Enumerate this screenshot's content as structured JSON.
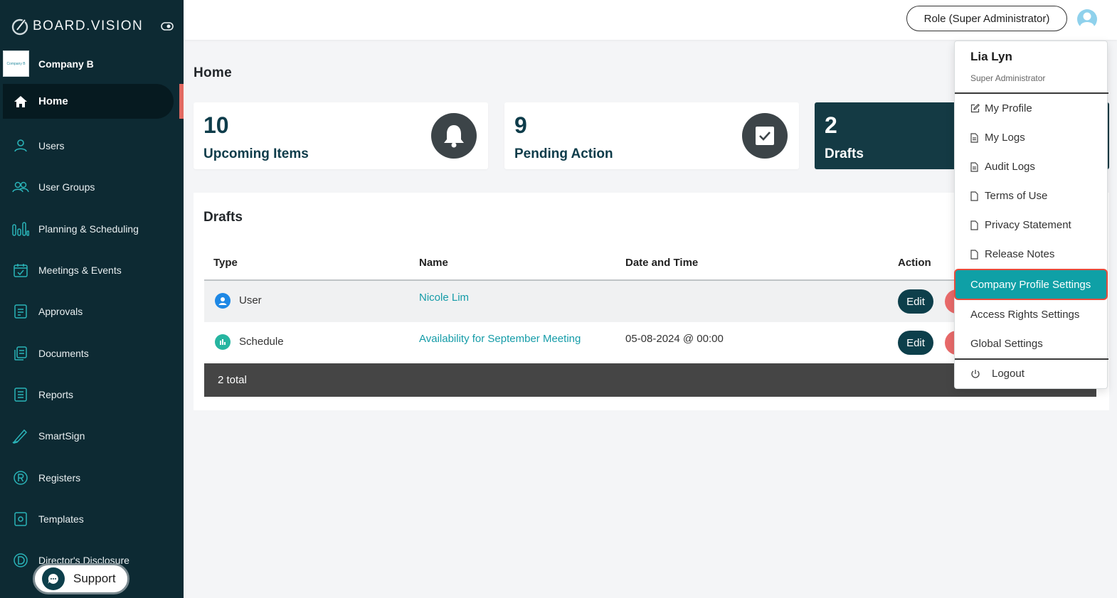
{
  "brand": {
    "name": "BOARD.VISION"
  },
  "company": {
    "name": "Company B",
    "logo_text": "Company B"
  },
  "sidebar": {
    "items": [
      {
        "label": "Home",
        "icon": "home-icon"
      },
      {
        "label": "Users",
        "icon": "user-icon"
      },
      {
        "label": "User Groups",
        "icon": "user-group-icon"
      },
      {
        "label": "Planning & Scheduling",
        "icon": "bar-chart-icon"
      },
      {
        "label": "Meetings & Events",
        "icon": "calendar-icon"
      },
      {
        "label": "Approvals",
        "icon": "approval-document-icon"
      },
      {
        "label": "Documents",
        "icon": "documents-icon"
      },
      {
        "label": "Reports",
        "icon": "report-list-icon"
      },
      {
        "label": "SmartSign",
        "icon": "pen-sign-icon"
      },
      {
        "label": "Registers",
        "icon": "registered-icon"
      },
      {
        "label": "Templates",
        "icon": "template-gear-icon"
      },
      {
        "label": "Director's Disclosure",
        "icon": "disclosure-d-icon"
      }
    ],
    "support_label": "Support"
  },
  "topbar": {
    "role_label": "Role (Super Administrator)"
  },
  "main": {
    "title": "Home",
    "cards": [
      {
        "value": "10",
        "label": "Upcoming Items",
        "icon": "bell-icon"
      },
      {
        "value": "9",
        "label": "Pending Action",
        "icon": "checkbox-icon"
      },
      {
        "value": "2",
        "label": "Drafts"
      }
    ],
    "drafts": {
      "title": "Drafts",
      "columns": [
        "Type",
        "Name",
        "Date and Time",
        "Action"
      ],
      "rows": [
        {
          "type": "User",
          "name": "Nicole Lim",
          "datetime": "",
          "edit": "Edit"
        },
        {
          "type": "Schedule",
          "name": "Availability for September Meeting",
          "datetime": "05-08-2024 @ 00:00",
          "edit": "Edit"
        }
      ],
      "total": "2 total"
    }
  },
  "user_menu": {
    "name": "Lia Lyn",
    "role": "Super Administrator",
    "items": [
      "My Profile",
      "My Logs",
      "Audit Logs",
      "Terms of Use",
      "Privacy Statement",
      "Release Notes",
      "Company Profile Settings",
      "Access Rights Settings",
      "Global Settings",
      "Logout"
    ]
  },
  "colors": {
    "sidebar": "#0d2a33",
    "accent": "#0fa0a6",
    "primary_dark": "#0e3c4a",
    "danger": "#e86a6a",
    "highlight_border": "#e74c3c"
  }
}
